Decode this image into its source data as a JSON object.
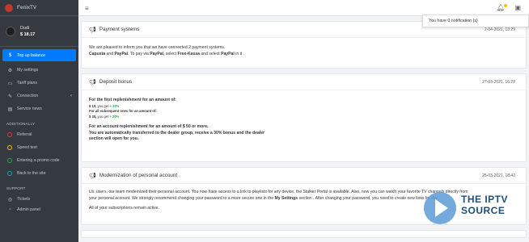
{
  "brand": {
    "name": "FenixTV"
  },
  "user": {
    "name": "Dudi",
    "balance": "$ 18.17"
  },
  "sidebar": {
    "items": [
      {
        "label": "Top up balance",
        "icon": "dollar-icon"
      },
      {
        "label": "My settings",
        "icon": "gears-icon"
      },
      {
        "label": "Tariff plans",
        "icon": "tv-icon"
      },
      {
        "label": "Connection",
        "icon": "plug-icon"
      },
      {
        "label": "Service news",
        "icon": "newspaper-icon"
      }
    ],
    "additionally_header": "ADDITIONALLY",
    "extra": [
      {
        "label": "Referral",
        "color": "#dc3545"
      },
      {
        "label": "Speed test",
        "color": "#ffc107"
      },
      {
        "label": "Entering a promo code",
        "color": "#28a745"
      },
      {
        "label": "Back to the site",
        "color": "#17a2b8"
      }
    ],
    "support_header": "SUPPORT",
    "support_items": [
      {
        "label": "Tickets",
        "icon": "support-icon"
      }
    ],
    "bottom_item": "Admin panel"
  },
  "notifications": {
    "text": "You have 0 notification (s)"
  },
  "news": [
    {
      "title": "Payment systems",
      "date": "2-04-2021, 13:29",
      "line1": "We are pleased to inform you that we have connected 2 payment systems.",
      "line2_a": "Capusta",
      "line2_b": " and ",
      "line2_c": "PayPal",
      "line2_d": ". To pay via ",
      "line2_e": "PayPal",
      "line2_f": ", select ",
      "line2_g": "Free-Kassa",
      "line2_h": " and select ",
      "line2_i": "PayPal",
      "line2_j": " in it ."
    },
    {
      "title": "Deposit bonus",
      "date": "27-03-2021, 16:22",
      "h1": "For the first replenishment for an amount of:",
      "r1a": "$ 10,",
      "r1b": " you get ",
      "r1c": "+ 10%",
      "h2": "For all subsequent ones for an amount of:",
      "r2a": "$ 30,",
      "r2b": " you get ",
      "r2c": "+ 20%",
      "p1": "For an account replenishment for an amount of $ 50 or more.",
      "p2": "You are automatically transferred to the dealer group, receive a 30% bonus and the dealer",
      "p3": "section will open for you."
    },
    {
      "title": "Modernization of personal account",
      "date": "25-03-2021, 18:42",
      "l1": "Us. users, our team modernized their personal account. You now have access to a link to playlists for any device, the Stalker Portal is available. Also, now you can watch your favorite TV channels directly from",
      "l2a": "your personal account. We strongly recommend changing your password to a more secure one in the ",
      "l2b": "My Settings",
      "l2c": " section . After changing your password, you need to create new links for the",
      "l3": "All of your subscriptions remain active."
    }
  ],
  "watermark": {
    "line1": "THE IPTV",
    "line2": "SOURCE"
  }
}
